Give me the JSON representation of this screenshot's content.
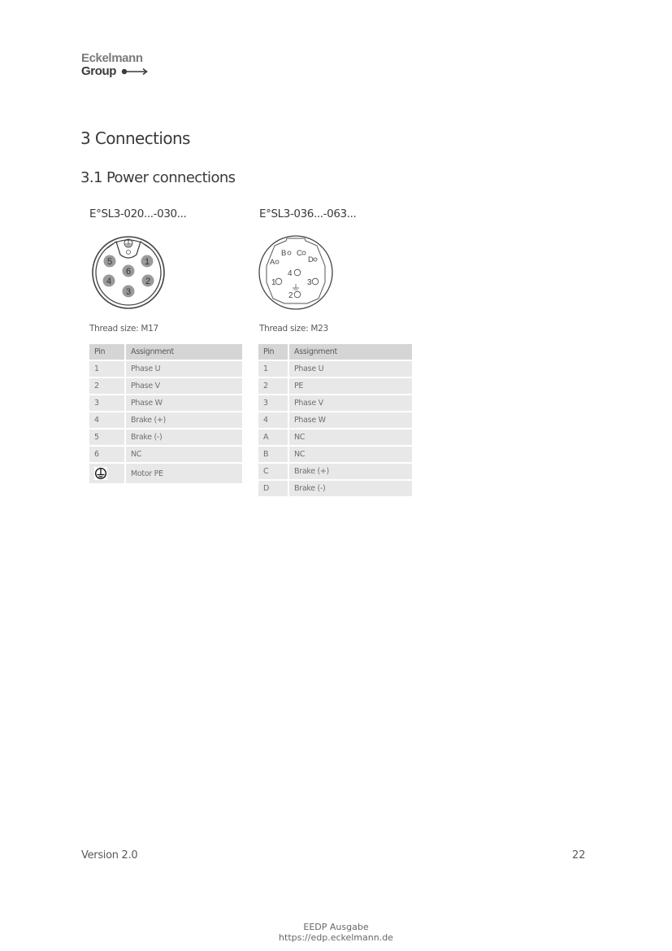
{
  "logo": {
    "line1": "Eckelmann",
    "line2": "Group",
    "arrow_icon": "arrow-right-icon"
  },
  "heading": "3 Connections",
  "subheading": "3.1 Power connections",
  "variants": [
    {
      "title": "E°SL3-020...-030...",
      "thread": "Thread size: M17",
      "connector_pins": [
        "1",
        "2",
        "3",
        "4",
        "5",
        "6",
        "PE"
      ],
      "table": {
        "headers": [
          "Pin",
          "Assignment"
        ],
        "rows": [
          {
            "pin": "1",
            "assignment": "Phase U"
          },
          {
            "pin": "2",
            "assignment": "Phase V"
          },
          {
            "pin": "3",
            "assignment": "Phase W"
          },
          {
            "pin": "4",
            "assignment": "Brake (+)"
          },
          {
            "pin": "5",
            "assignment": "Brake (-)"
          },
          {
            "pin": "6",
            "assignment": "NC"
          },
          {
            "pin": "ground-icon",
            "assignment": "Motor PE"
          }
        ]
      }
    },
    {
      "title": "E°SL3-036...-063...",
      "thread": "Thread size: M23",
      "connector_pins": [
        "A",
        "B",
        "C",
        "D",
        "1",
        "2",
        "3",
        "4"
      ],
      "table": {
        "headers": [
          "Pin",
          "Assignment"
        ],
        "rows": [
          {
            "pin": "1",
            "assignment": "Phase U"
          },
          {
            "pin": "2",
            "assignment": "PE"
          },
          {
            "pin": "3",
            "assignment": "Phase V"
          },
          {
            "pin": "4",
            "assignment": "Phase W"
          },
          {
            "pin": "A",
            "assignment": "NC"
          },
          {
            "pin": "B",
            "assignment": "NC"
          },
          {
            "pin": "C",
            "assignment": "Brake (+)"
          },
          {
            "pin": "D",
            "assignment": "Brake (-)"
          }
        ]
      }
    }
  ],
  "footer": {
    "version": "Version 2.0",
    "page": "22"
  },
  "stamp": {
    "line1": "EEDP Ausgabe",
    "line2": "https://edp.eckelmann.de"
  }
}
